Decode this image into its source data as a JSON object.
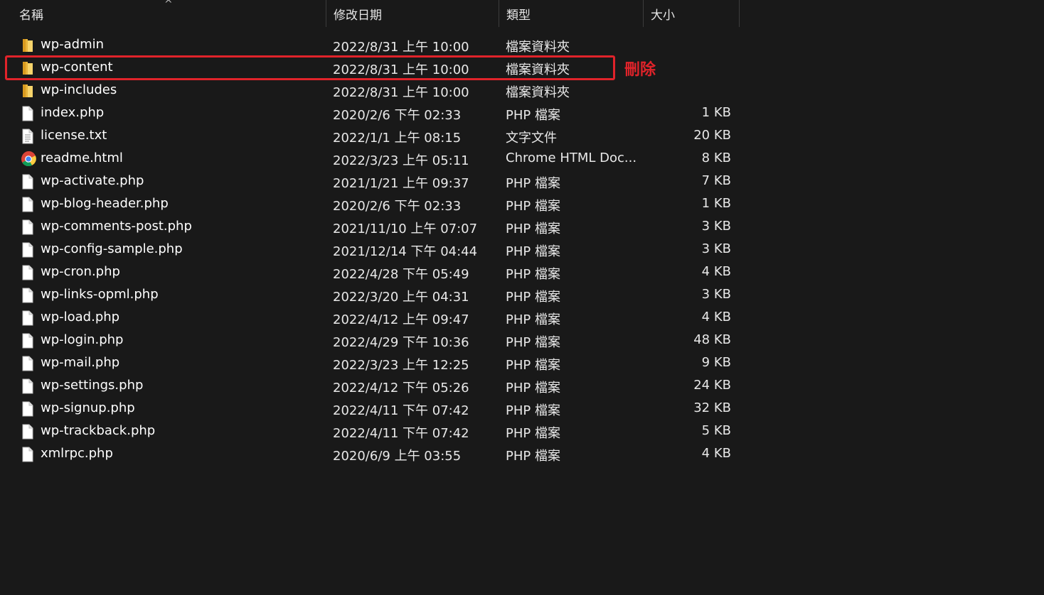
{
  "columns": {
    "name": "名稱",
    "date": "修改日期",
    "type": "類型",
    "size": "大小",
    "sort_indicator": "^"
  },
  "annotation": {
    "label": "刪除",
    "color": "#e0232a"
  },
  "files": [
    {
      "name": "wp-admin",
      "date": "2022/8/31 上午 10:00",
      "type": "檔案資料夾",
      "size": "",
      "icon": "folder-icon"
    },
    {
      "name": "wp-content",
      "date": "2022/8/31 上午 10:00",
      "type": "檔案資料夾",
      "size": "",
      "icon": "folder-icon"
    },
    {
      "name": "wp-includes",
      "date": "2022/8/31 上午 10:00",
      "type": "檔案資料夾",
      "size": "",
      "icon": "folder-icon"
    },
    {
      "name": "index.php",
      "date": "2020/2/6 下午 02:33",
      "type": "PHP 檔案",
      "size": "1 KB",
      "icon": "file-icon"
    },
    {
      "name": "license.txt",
      "date": "2022/1/1 上午 08:15",
      "type": "文字文件",
      "size": "20 KB",
      "icon": "text-file-icon"
    },
    {
      "name": "readme.html",
      "date": "2022/3/23 上午 05:11",
      "type": "Chrome HTML Doc...",
      "size": "8 KB",
      "icon": "chrome-icon"
    },
    {
      "name": "wp-activate.php",
      "date": "2021/1/21 上午 09:37",
      "type": "PHP 檔案",
      "size": "7 KB",
      "icon": "file-icon"
    },
    {
      "name": "wp-blog-header.php",
      "date": "2020/2/6 下午 02:33",
      "type": "PHP 檔案",
      "size": "1 KB",
      "icon": "file-icon"
    },
    {
      "name": "wp-comments-post.php",
      "date": "2021/11/10 上午 07:07",
      "type": "PHP 檔案",
      "size": "3 KB",
      "icon": "file-icon"
    },
    {
      "name": "wp-config-sample.php",
      "date": "2021/12/14 下午 04:44",
      "type": "PHP 檔案",
      "size": "3 KB",
      "icon": "file-icon"
    },
    {
      "name": "wp-cron.php",
      "date": "2022/4/28 下午 05:49",
      "type": "PHP 檔案",
      "size": "4 KB",
      "icon": "file-icon"
    },
    {
      "name": "wp-links-opml.php",
      "date": "2022/3/20 上午 04:31",
      "type": "PHP 檔案",
      "size": "3 KB",
      "icon": "file-icon"
    },
    {
      "name": "wp-load.php",
      "date": "2022/4/12 上午 09:47",
      "type": "PHP 檔案",
      "size": "4 KB",
      "icon": "file-icon"
    },
    {
      "name": "wp-login.php",
      "date": "2022/4/29 下午 10:36",
      "type": "PHP 檔案",
      "size": "48 KB",
      "icon": "file-icon"
    },
    {
      "name": "wp-mail.php",
      "date": "2022/3/23 上午 12:25",
      "type": "PHP 檔案",
      "size": "9 KB",
      "icon": "file-icon"
    },
    {
      "name": "wp-settings.php",
      "date": "2022/4/12 下午 05:26",
      "type": "PHP 檔案",
      "size": "24 KB",
      "icon": "file-icon"
    },
    {
      "name": "wp-signup.php",
      "date": "2022/4/11 下午 07:42",
      "type": "PHP 檔案",
      "size": "32 KB",
      "icon": "file-icon"
    },
    {
      "name": "wp-trackback.php",
      "date": "2022/4/11 下午 07:42",
      "type": "PHP 檔案",
      "size": "5 KB",
      "icon": "file-icon"
    },
    {
      "name": "xmlrpc.php",
      "date": "2020/6/9 上午 03:55",
      "type": "PHP 檔案",
      "size": "4 KB",
      "icon": "file-icon"
    }
  ]
}
